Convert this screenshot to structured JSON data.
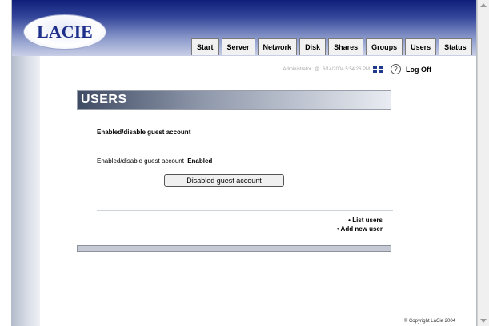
{
  "logo": {
    "text": "LACIE"
  },
  "nav": {
    "tabs": [
      {
        "label": "Start"
      },
      {
        "label": "Server"
      },
      {
        "label": "Network"
      },
      {
        "label": "Disk"
      },
      {
        "label": "Shares"
      },
      {
        "label": "Groups"
      },
      {
        "label": "Users"
      },
      {
        "label": "Status"
      }
    ]
  },
  "infobar": {
    "user": "Administrator",
    "at": "@",
    "datetime": "6/14/2004 5:54:26 PM",
    "logoff": "Log Off"
  },
  "section": {
    "title": "USERS"
  },
  "guest": {
    "heading": "Enabled/disable guest account",
    "field_label": "Enabled/disable guest account",
    "field_value": "Enabled",
    "button_label": "Disabled guest account"
  },
  "links": {
    "list_users": "• List users",
    "add_new_user": "• Add new user"
  },
  "footer": {
    "copyright": "© Copyright LaCie 2004"
  },
  "icons": {
    "flag": "uk-flag-icon",
    "help": "help-icon",
    "scroll_up": "scroll-up-icon",
    "scroll_down": "scroll-down-icon"
  },
  "colors": {
    "header_dark": "#0f1f7a",
    "header_light": "#c9cfe6",
    "banner_dark": "#3f4b63"
  }
}
